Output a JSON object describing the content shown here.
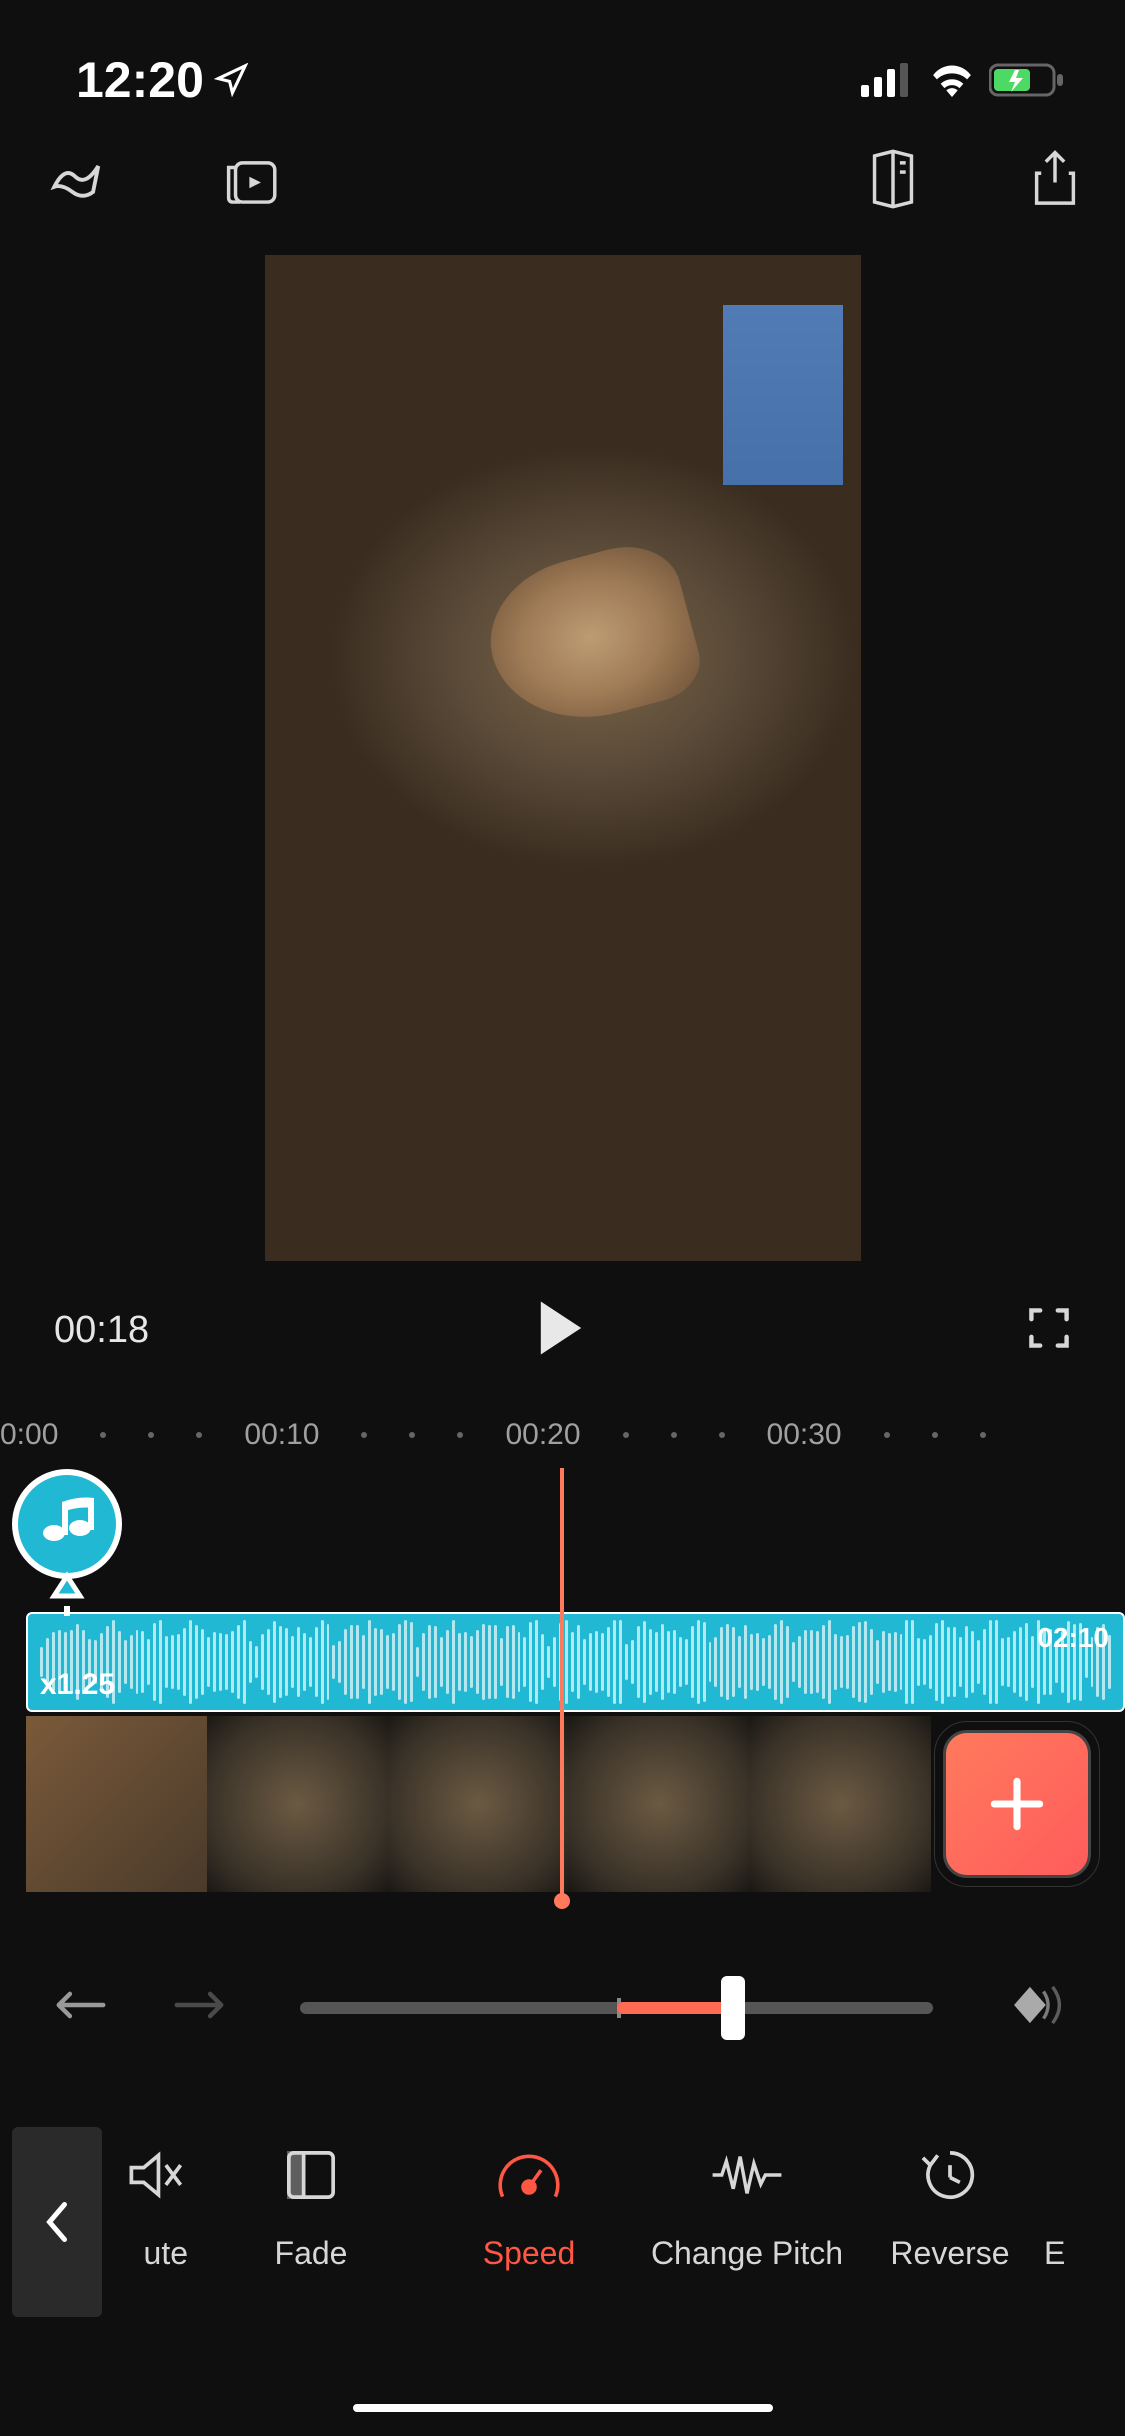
{
  "status": {
    "time": "12:20"
  },
  "playback": {
    "current_time": "00:18"
  },
  "ruler": [
    {
      "label": "0:00"
    },
    {
      "label": "00:10"
    },
    {
      "label": "00:20"
    },
    {
      "label": "00:30"
    }
  ],
  "audio": {
    "speed_label": "x1.25",
    "duration": "02:10"
  },
  "controls": {
    "slider_value": 1.25
  },
  "tools": {
    "mute": "ute",
    "fade": "Fade",
    "speed": "Speed",
    "change_pitch": "Change Pitch",
    "reverse": "Reverse",
    "edge": "E"
  }
}
